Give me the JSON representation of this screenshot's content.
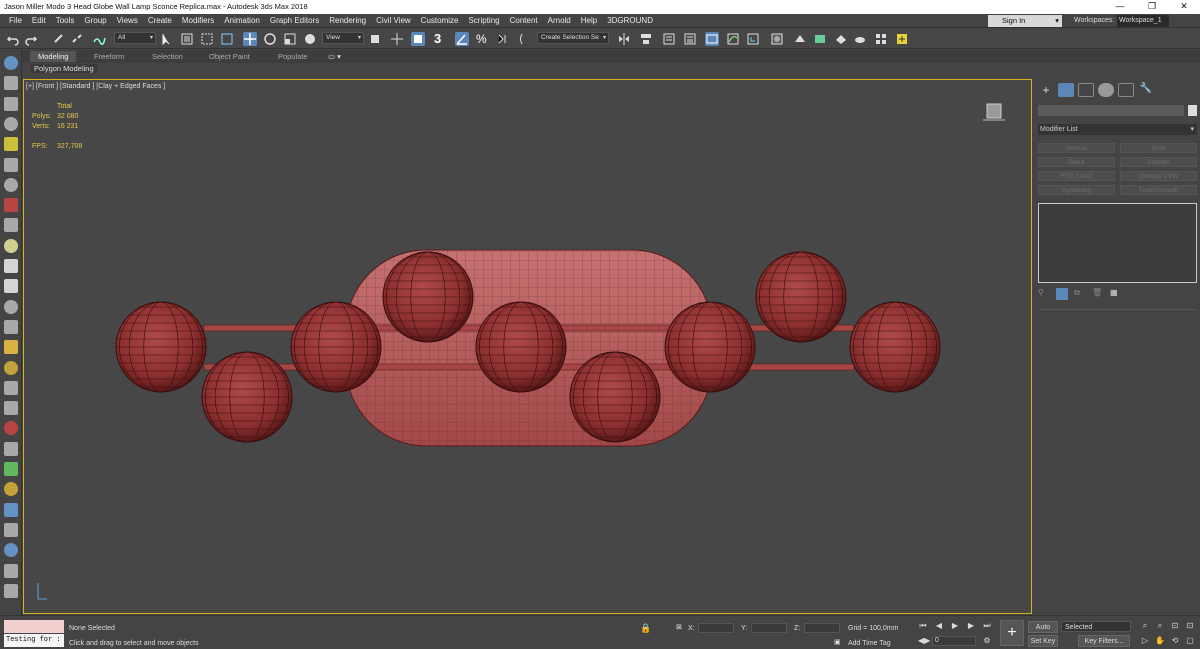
{
  "window": {
    "title": "Jason Miller Modo 3 Head Globe Wall Lamp Sconce Replica.max - Autodesk 3ds Max 2018",
    "min": "—",
    "max": "❐",
    "close": "✕"
  },
  "menu": {
    "items": [
      "File",
      "Edit",
      "Tools",
      "Group",
      "Views",
      "Create",
      "Modifiers",
      "Animation",
      "Graph Editors",
      "Rendering",
      "Civil View",
      "Customize",
      "Scripting",
      "Content",
      "Arnold",
      "Help",
      "3DGROUND"
    ],
    "signin": "Sign In",
    "workspaces_label": "Workspaces:",
    "workspace_value": "Workspace_1"
  },
  "toolbar": {
    "selection_filter": "All",
    "ref_coord": "View",
    "snap_label": "3",
    "angle_snap": "%",
    "selection_set": "Create Selection Se"
  },
  "ribbon": {
    "tabs": [
      "Modeling",
      "Freeform",
      "Selection",
      "Object Paint",
      "Populate"
    ],
    "active": "Modeling",
    "sub": "Polygon Modeling"
  },
  "viewport": {
    "label": "[+] [Front ] [Standard ] [Clay + Edged Faces ]",
    "stats_header": "Total",
    "polys_label": "Polys:",
    "polys_value": "32 080",
    "verts_label": "Verts:",
    "verts_value": "16 231",
    "fps_label": "FPS:",
    "fps_value": "327,708",
    "model_color": "#9c3b3b"
  },
  "command_panel": {
    "modifier_list": "Modifier List",
    "buttons": [
      "Normal",
      "Shell",
      "Bend",
      "Smooth",
      "FFD 2x2x2",
      "Unwrap UVW",
      "Symmetry",
      "TurboSmooth"
    ]
  },
  "status": {
    "maxscript_hint": "Testing for :",
    "selection": "None Selected",
    "prompt": "Click and drag to select and move objects",
    "x_label": "X:",
    "y_label": "Y:",
    "z_label": "Z:",
    "grid": "Grid = 100,0mm",
    "add_time_tag": "Add Time Tag",
    "auto_key": "Auto Key",
    "set_key": "Set Key",
    "key_mode": "Selected",
    "key_filters": "Key Filters...",
    "frame": "0"
  }
}
